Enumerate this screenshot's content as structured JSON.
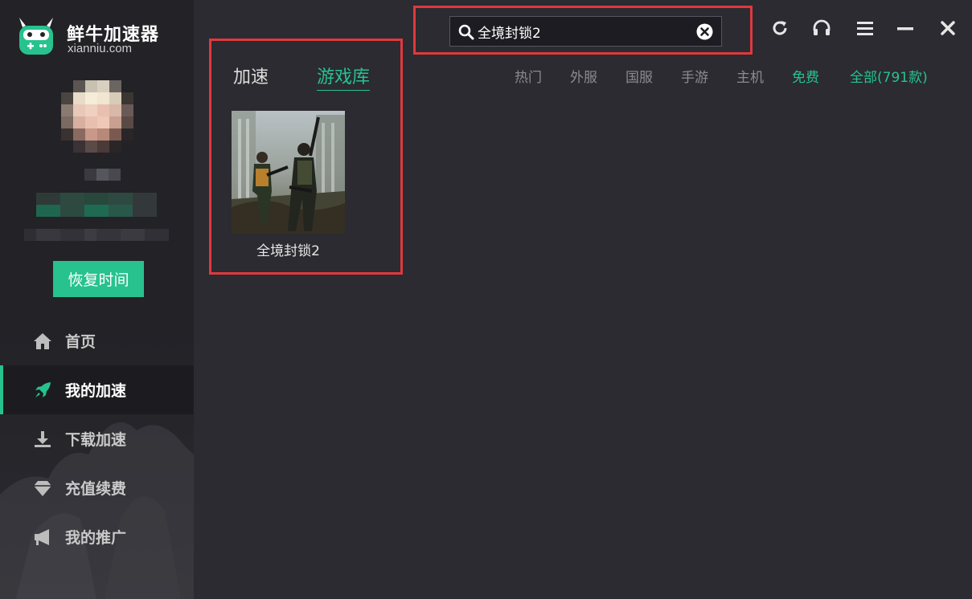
{
  "app": {
    "name": "鲜牛加速器",
    "domain": "xianniu.com"
  },
  "sidebar": {
    "restore_button": "恢复时间",
    "items": [
      {
        "label": "首页",
        "icon": "home-icon"
      },
      {
        "label": "我的加速",
        "icon": "rocket-icon",
        "active": true
      },
      {
        "label": "下载加速",
        "icon": "download-icon"
      },
      {
        "label": "充值续费",
        "icon": "diamond-icon"
      },
      {
        "label": "我的推广",
        "icon": "megaphone-icon"
      }
    ]
  },
  "search": {
    "value": "全境封锁2"
  },
  "window_controls": [
    "refresh-icon",
    "headset-icon",
    "menu-icon",
    "minimize-icon",
    "close-icon"
  ],
  "tabs": {
    "accelerate": "加速",
    "library": "游戏库",
    "active": "游戏库"
  },
  "filters": [
    {
      "label": "热门"
    },
    {
      "label": "外服"
    },
    {
      "label": "国服"
    },
    {
      "label": "手游"
    },
    {
      "label": "主机"
    },
    {
      "label": "免费"
    },
    {
      "label": "全部(791款)"
    }
  ],
  "games": [
    {
      "title": "全境封锁2"
    }
  ],
  "colors": {
    "accent": "#27c28e",
    "highlight": "#e0393d",
    "background": "#2b2b31",
    "sidebar": "#222227"
  }
}
